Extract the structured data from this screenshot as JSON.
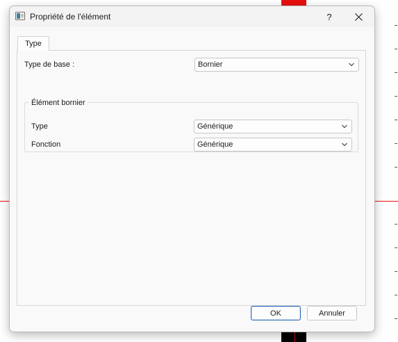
{
  "window": {
    "title": "Propriété de l'élément",
    "help_label": "?",
    "close_icon": "close-icon"
  },
  "tabs": [
    {
      "label": "Type",
      "active": true
    }
  ],
  "form": {
    "base_type_label": "Type de base :",
    "base_type_value": "Bornier",
    "group_title": "Élément bornier",
    "type_label": "Type",
    "type_value": "Générique",
    "function_label": "Fonction",
    "function_value": "Générique"
  },
  "buttons": {
    "ok_label": "OK",
    "cancel_label": "Annuler"
  },
  "colors": {
    "accent_border": "#2b67b8",
    "background_red": "#e81010"
  }
}
